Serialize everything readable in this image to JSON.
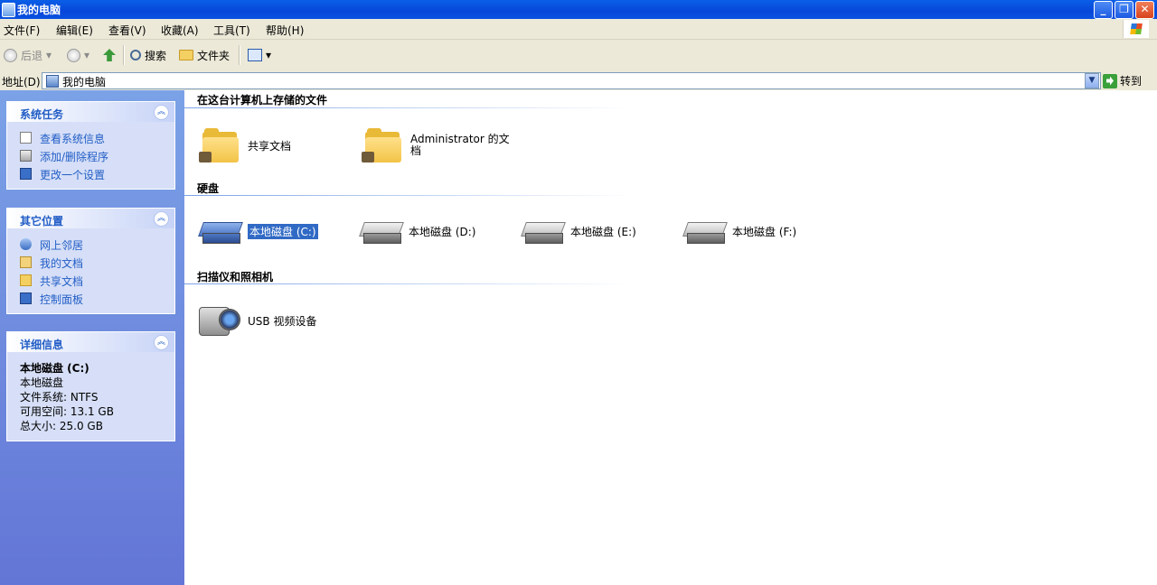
{
  "window": {
    "title": "我的电脑",
    "controls": {
      "minimize": "_",
      "maximize": "❐",
      "close": "✕"
    }
  },
  "menu": [
    "文件(F)",
    "编辑(E)",
    "查看(V)",
    "收藏(A)",
    "工具(T)",
    "帮助(H)"
  ],
  "toolbar": {
    "back_label": "后退",
    "search_label": "搜索",
    "folders_label": "文件夹"
  },
  "address": {
    "label": "地址(D)",
    "value": "我的电脑",
    "go_label": "转到"
  },
  "sidebar": {
    "system_tasks": {
      "title": "系统任务",
      "items": [
        {
          "label": "查看系统信息",
          "icon": "system-info-icon"
        },
        {
          "label": "添加/删除程序",
          "icon": "add-remove-programs-icon"
        },
        {
          "label": "更改一个设置",
          "icon": "control-panel-icon"
        }
      ]
    },
    "other_places": {
      "title": "其它位置",
      "items": [
        {
          "label": "网上邻居",
          "icon": "network-places-icon"
        },
        {
          "label": "我的文档",
          "icon": "my-documents-icon"
        },
        {
          "label": "共享文档",
          "icon": "shared-documents-icon"
        },
        {
          "label": "控制面板",
          "icon": "control-panel-icon"
        }
      ]
    },
    "details": {
      "title": "详细信息",
      "name": "本地磁盘 (C:)",
      "type": "本地磁盘",
      "fs": "文件系统: NTFS",
      "free": "可用空间: 13.1 GB",
      "total": "总大小: 25.0 GB"
    }
  },
  "main": {
    "groups": {
      "stored_files": {
        "title": "在这台计算机上存储的文件",
        "items": [
          "共享文档",
          "Administrator 的文档"
        ]
      },
      "hard_drives": {
        "title": "硬盘",
        "items": [
          "本地磁盘 (C:)",
          "本地磁盘 (D:)",
          "本地磁盘 (E:)",
          "本地磁盘 (F:)"
        ],
        "selected": "本地磁盘 (C:)"
      },
      "scanners": {
        "title": "扫描仪和照相机",
        "items": [
          "USB 视频设备"
        ]
      }
    }
  },
  "colors": {
    "titlebar": "#0a52e0",
    "sidebar_top": "#7ba2e7",
    "link": "#215dc6",
    "selection": "#316ac5"
  }
}
